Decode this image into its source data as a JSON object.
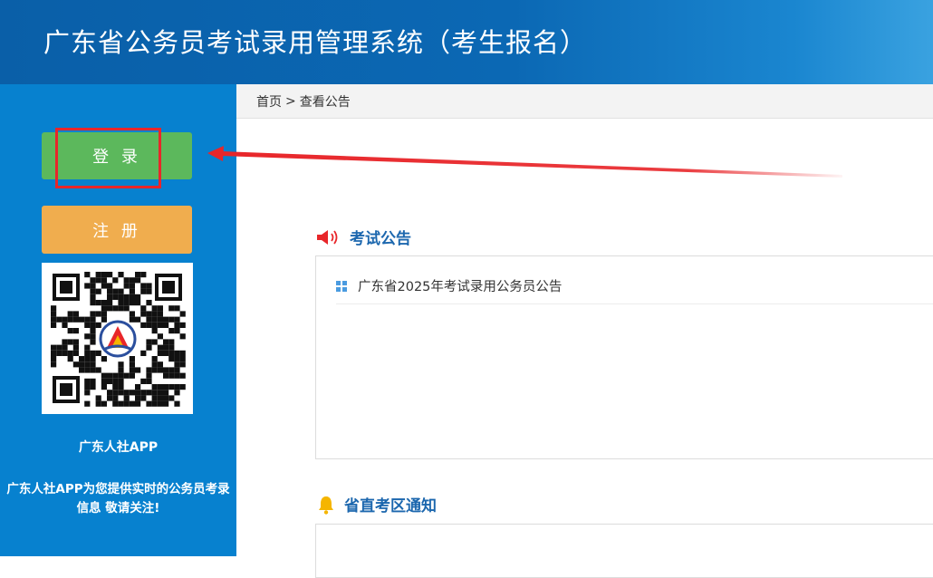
{
  "header": {
    "title": "广东省公务员考试录用管理系统（考生报名）"
  },
  "sidebar": {
    "login_label": "登 录",
    "register_label": "注 册",
    "app_name": "广东人社APP",
    "app_desc": "广东人社APP为您提供实时的公务员考录信息 敬请关注!"
  },
  "breadcrumb": {
    "home": "首页",
    "separator": ">",
    "current": "查看公告"
  },
  "sections": {
    "exam_notice": {
      "title": "考试公告",
      "items": [
        "广东省2025年考试录用公务员公告"
      ]
    },
    "district_notice": {
      "title": "省直考区通知"
    }
  },
  "colors": {
    "header_bg": "#0b68b4",
    "sidebar_bg": "#0781cf",
    "login_button": "#5cb85c",
    "register_button": "#f0ad4e",
    "section_title": "#1c67ae",
    "annotation_red": "#e8262a"
  },
  "icons": {
    "exam_notice": "speaker-icon",
    "district_notice": "bell-icon",
    "list_bullet": "grid-square-icon"
  }
}
